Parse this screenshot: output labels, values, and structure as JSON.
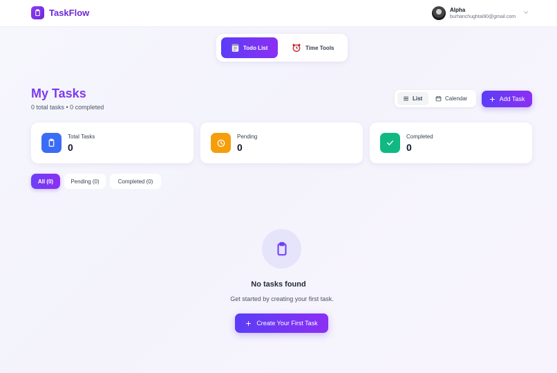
{
  "app": {
    "name": "TaskFlow"
  },
  "user": {
    "name": "Alpha",
    "email": "burhanchughtai90@gmail.com"
  },
  "tools": {
    "todo_label": "Todo List",
    "time_label": "Time Tools"
  },
  "page": {
    "title": "My Tasks",
    "subtitle": "0 total tasks • 0 completed"
  },
  "view_toggle": {
    "list_label": "List",
    "calendar_label": "Calendar",
    "active": "List"
  },
  "actions": {
    "add_task_label": "Add Task"
  },
  "stats": [
    {
      "label": "Total Tasks",
      "value": "0",
      "color": "#3b6cf6",
      "icon": "clipboard-icon"
    },
    {
      "label": "Pending",
      "value": "0",
      "color": "#f59e0b",
      "icon": "clock-icon"
    },
    {
      "label": "Completed",
      "value": "0",
      "color": "#10b981",
      "icon": "check-icon"
    }
  ],
  "filters": [
    {
      "label": "All (0)",
      "active": true
    },
    {
      "label": "Pending (0)",
      "active": false
    },
    {
      "label": "Completed (0)",
      "active": false
    }
  ],
  "empty_state": {
    "title": "No tasks found",
    "description": "Get started by creating your first task.",
    "button_label": "Create Your First Task",
    "icon": "clipboard-icon"
  },
  "colors": {
    "accent": "#6d28d9",
    "gradient_start": "#5b3df6",
    "gradient_end": "#8b2ff3"
  }
}
